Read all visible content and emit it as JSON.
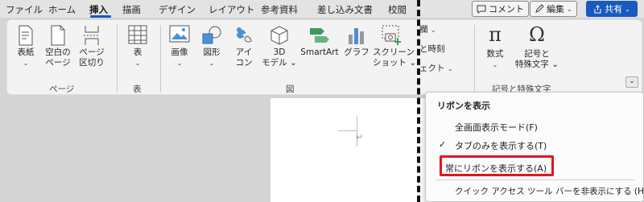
{
  "tabs": [
    "ファイル",
    "ホーム",
    "挿入",
    "描画",
    "デザイン",
    "レイアウト",
    "参考資料",
    "差し込み文書",
    "校閲"
  ],
  "header_buttons": {
    "comment": "コメント",
    "edit": "編集",
    "share": "共有"
  },
  "ribbon": {
    "page_group": {
      "label": "ページ",
      "buttons": [
        {
          "line1": "表紙",
          "line2": "⌄"
        },
        {
          "line1": "空白の",
          "line2": "ページ"
        },
        {
          "line1": "ページ",
          "line2": "区切り"
        }
      ]
    },
    "table_group": {
      "label": "表",
      "button": {
        "line1": "表",
        "line2": "⌄"
      }
    },
    "illustrations_group": {
      "label": "図",
      "buttons": [
        {
          "line1": "画像",
          "line2": "⌄"
        },
        {
          "line1": "図形",
          "line2": "⌄"
        },
        {
          "line1": "アイ",
          "line2": "コン"
        },
        {
          "line1": "3D",
          "line2": "モデル ⌄"
        },
        {
          "line1": "SmartArt",
          "line2": ""
        },
        {
          "line1": "グラフ",
          "line2": ""
        },
        {
          "line1": "スクリーン",
          "line2": "ショット ⌄"
        }
      ]
    },
    "partial_group": {
      "items": [
        "欄",
        "と時刻",
        "ェクト"
      ]
    },
    "symbols_group": {
      "label": "記号と特殊文字",
      "buttons": [
        {
          "line1": "数式",
          "line2": "⌄"
        },
        {
          "line1": "記号と",
          "line2": "特殊文字 ⌄"
        }
      ]
    },
    "collapse_icon": "⌄"
  },
  "popup_menu": {
    "title": "リボンを表示",
    "items": [
      "全画面表示モード(F)",
      "タブのみを表示する(T)",
      "常にリボンを表示する(A)",
      "クイック アクセス ツール バーを非表示にする (H)"
    ],
    "checked_index": 1,
    "highlighted_index": 2,
    "checkmark": "✓"
  },
  "document": {
    "paragraph_mark": "↵"
  },
  "colors": {
    "accent": "#185abd",
    "highlight": "#e8131b"
  }
}
